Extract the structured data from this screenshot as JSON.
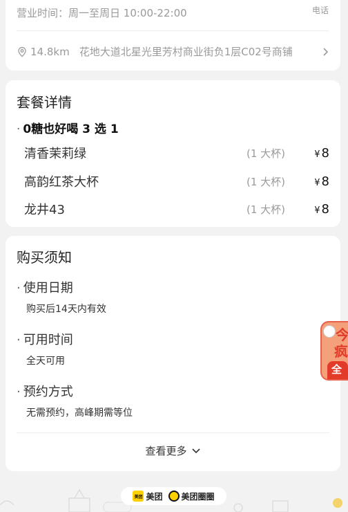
{
  "store": {
    "hours_label": "营业时间：",
    "hours_value": "周一至周日 10:00-22:00",
    "phone_label": "电话",
    "distance": "14.8km",
    "address": "花地大道北星光里芳村商业街负1层C02号商铺"
  },
  "package": {
    "title": "套餐详情",
    "group_title": "0糖也好喝 3 选 1",
    "currency": "¥",
    "items": [
      {
        "name": "清香茉莉绿",
        "qty": "(1 大杯)",
        "price": "8"
      },
      {
        "name": "高韵红茶大杯",
        "qty": "(1 大杯)",
        "price": "8"
      },
      {
        "name": "龙井43",
        "qty": "(1 大杯)",
        "price": "8"
      }
    ]
  },
  "notice": {
    "title": "购买须知",
    "sections": [
      {
        "heading": "使用日期",
        "body": "购买后14天内有效"
      },
      {
        "heading": "可用时间",
        "body": "全天可用"
      },
      {
        "heading": "预约方式",
        "body": "无需预约，高峰期需等位"
      }
    ],
    "more_label": "查看更多"
  },
  "promo": {
    "line1": "今",
    "line2": "疯",
    "badge": "全网"
  },
  "footer": {
    "brand1_logo": "美团",
    "brand1": "美团",
    "brand2": "美团圈圈"
  },
  "icons": {
    "location": "location-pin-icon",
    "chevron_right": "chevron-right-icon",
    "chevron_down": "chevron-down-icon"
  }
}
